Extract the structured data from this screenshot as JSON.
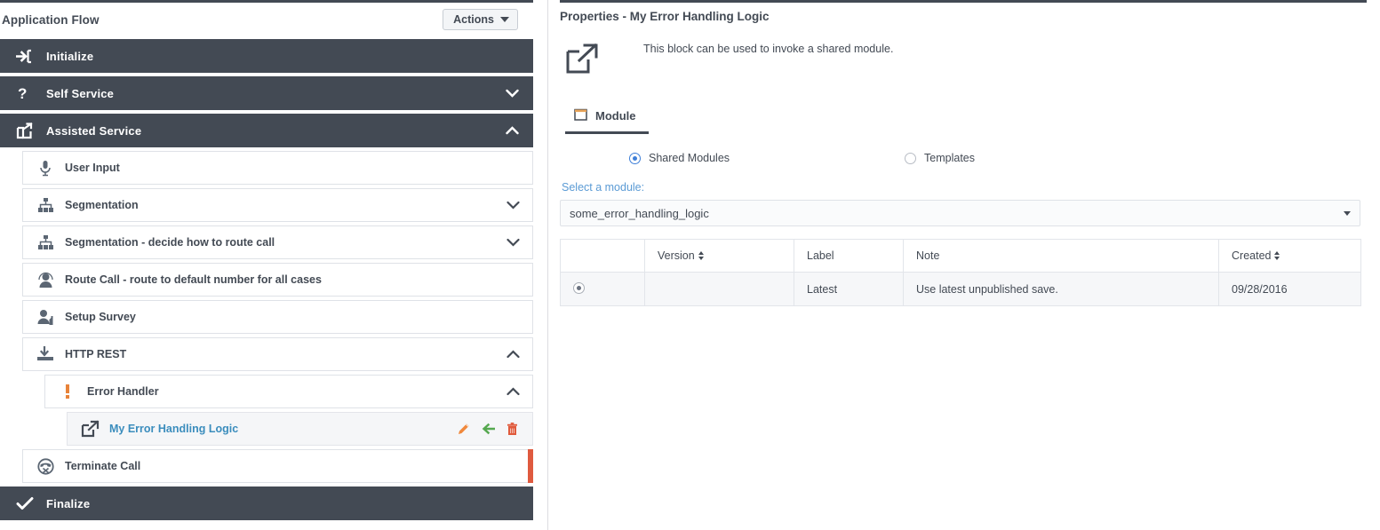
{
  "left": {
    "title": "Application Flow",
    "actions_button": "Actions",
    "rows": [
      {
        "label": "Initialize",
        "icon": "sign-in-icon",
        "level": "top",
        "chevron": "none"
      },
      {
        "label": "Self Service",
        "icon": "question-mark-icon",
        "level": "top",
        "chevron": "down"
      },
      {
        "label": "Assisted Service",
        "icon": "share-square-icon",
        "level": "top",
        "chevron": "up"
      },
      {
        "label": "User Input",
        "icon": "microphone-icon",
        "level": "1",
        "chevron": "none"
      },
      {
        "label": "Segmentation",
        "icon": "sitemap-icon",
        "level": "1",
        "chevron": "down"
      },
      {
        "label": "Segmentation - decide how to route call",
        "icon": "sitemap-icon",
        "level": "1",
        "chevron": "down"
      },
      {
        "label": "Route Call - route to default number for all cases",
        "icon": "user-circle-icon",
        "level": "1",
        "chevron": "none"
      },
      {
        "label": "Setup Survey",
        "icon": "user-survey-icon",
        "level": "1",
        "chevron": "none"
      },
      {
        "label": "HTTP REST",
        "icon": "download-tray-icon",
        "level": "1",
        "chevron": "up"
      },
      {
        "label": "Error Handler",
        "icon": "exclamation-icon",
        "level": "2",
        "chevron": "up"
      },
      {
        "label": "My Error Handling Logic",
        "icon": "external-link-icon",
        "level": "3",
        "chevron": "none"
      },
      {
        "label": "Terminate Call",
        "icon": "phone-end-icon",
        "level": "1",
        "chevron": "none"
      },
      {
        "label": "Finalize",
        "icon": "check-icon",
        "level": "top",
        "chevron": "none"
      }
    ],
    "selected_row_actions": {
      "edit": "edit-pencil",
      "goto": "goto-arrow",
      "delete": "delete-trash"
    }
  },
  "right": {
    "title": "Properties - My Error Handling Logic",
    "description": "This block can be used to invoke a shared module.",
    "block_icon": "external-link-icon",
    "tab": {
      "label": "Module",
      "icon": "window-icon"
    },
    "radios": [
      {
        "label": "Shared Modules",
        "checked": true
      },
      {
        "label": "Templates",
        "checked": false
      }
    ],
    "select": {
      "label": "Select a module:",
      "value": "some_error_handling_logic"
    },
    "table": {
      "headers": [
        "",
        "Version",
        "Label",
        "Note",
        "Created"
      ],
      "sortable": [
        "Version",
        "Created"
      ],
      "rows": [
        {
          "selected": true,
          "version": "",
          "label": "Latest",
          "note": "Use latest unpublished save.",
          "created": "09/28/2016"
        }
      ]
    }
  },
  "colors": {
    "dark_bar": "#434a54",
    "accent_orange": "#df5a3f",
    "link_blue": "#3b8dbd",
    "label_blue": "#5b9bd5",
    "radio_blue": "#3e7fd8",
    "edit_orange": "#f0833a",
    "goto_green": "#5cb85c",
    "delete_red": "#e05a3c"
  }
}
